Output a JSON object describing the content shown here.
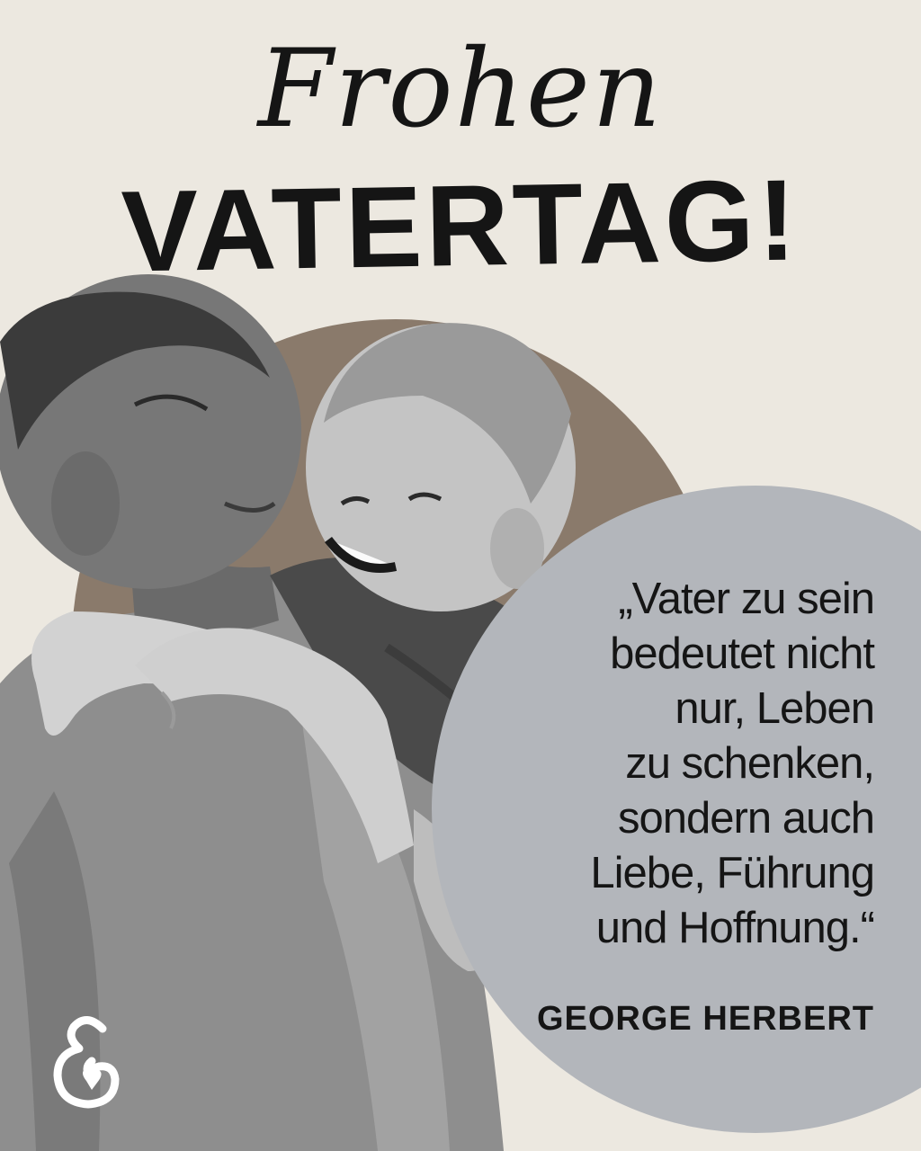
{
  "title": {
    "line1": "Frohen",
    "line2": "VATERTAG!"
  },
  "quote": {
    "lines": [
      "„Vater zu sein",
      "bedeutet nicht",
      "nur, Leben",
      "zu schenken,",
      "sondern auch",
      "Liebe, Führung",
      "und Hoffnung.“"
    ],
    "author": "GEORGE HERBERT"
  },
  "photo": {
    "subject": "father carrying smiling son on his back"
  },
  "logo": {
    "icon": "heart-e-logo-icon"
  },
  "colors": {
    "background": "#ece8e0",
    "brown_circle": "#8a7a6b",
    "quote_circle": "#b3b6bb",
    "text": "#151515"
  }
}
